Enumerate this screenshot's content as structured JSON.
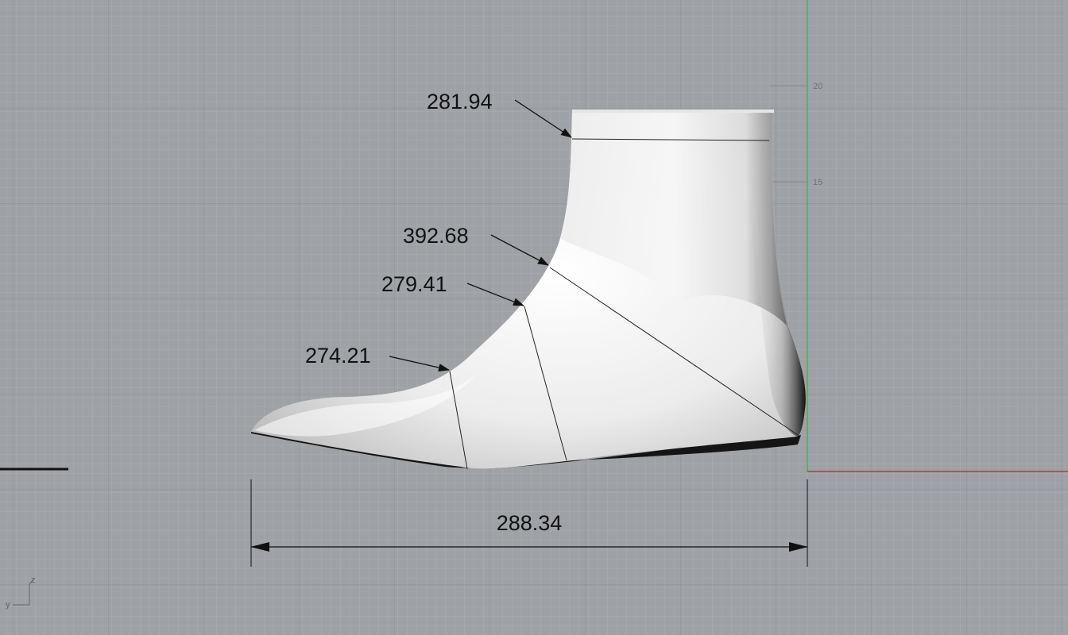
{
  "viewport": {
    "view": "Right",
    "background_color": "#9ea1a6",
    "grid_minor_color": "#a9acb1",
    "grid_major_color": "#8f9297",
    "x_axis_color": "#c0392b",
    "z_axis_color": "#4caf50"
  },
  "ruler": {
    "ticks": [
      "20",
      "15"
    ]
  },
  "axis_widget": {
    "vertical_label": "z",
    "horizontal_label": "y"
  },
  "measurements": {
    "ankle_girth": "281.94",
    "heel_girth": "392.68",
    "instep_girth": "279.41",
    "ball_girth": "274.21",
    "length": "288.34"
  },
  "model": {
    "type": "foot-last",
    "surface_color": "#f2f2f2",
    "shadow_color": "#1a1a1a"
  }
}
